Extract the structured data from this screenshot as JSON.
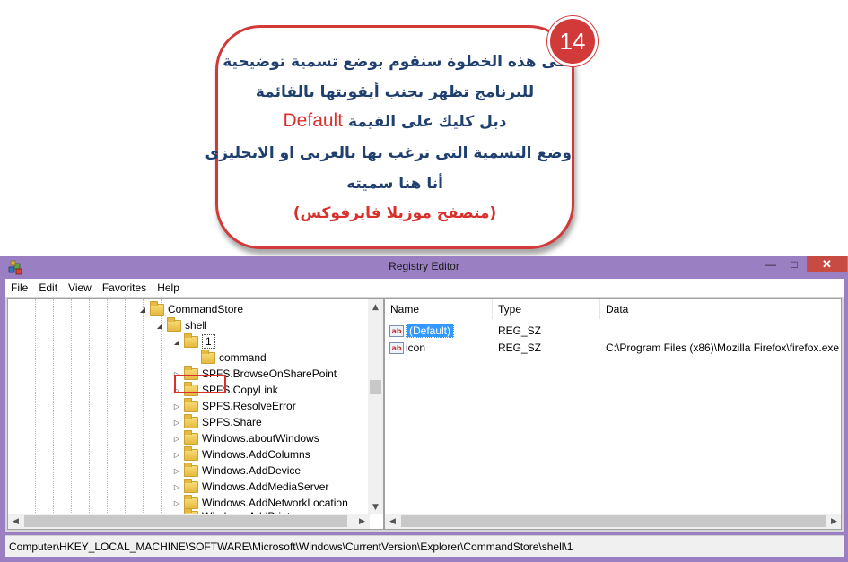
{
  "callout": {
    "badge_number": "14",
    "line1": "فى هذه الخطوة سنقوم بوضع تسمية توضيحية",
    "line2": "للبرنامج تظهر بجنب أيقونتها بالقائمة",
    "line3_prefix": "دبل كليك على القيمة",
    "line3_highlight": "Default",
    "line4": "وضع التسمية التى ترغب بها بالعربى او الانجليزى",
    "line5": "أنا هنا سميته",
    "line6": "(متصفح موزيلا فايرفوكس)",
    "accent_color": "#d23a3a",
    "text_color": "#1f3f6e"
  },
  "window": {
    "title": "Registry Editor",
    "app_icon": "registry-cubes-icon",
    "frame_color": "#9b7fc3",
    "minimize_glyph": "—",
    "maximize_glyph": "□",
    "close_glyph": "✕"
  },
  "menu": [
    "File",
    "Edit",
    "View",
    "Favorites",
    "Help"
  ],
  "tree": {
    "items": [
      {
        "label": "CommandStore",
        "expander": "◢"
      },
      {
        "label": "shell",
        "expander": "◢"
      },
      {
        "label": "1",
        "expander": "◢",
        "selected": true
      },
      {
        "label": "command",
        "expander": ""
      },
      {
        "label": "SPFS.BrowseOnSharePoint",
        "expander": "▷"
      },
      {
        "label": "SPFS.CopyLink",
        "expander": "▷"
      },
      {
        "label": "SPFS.ResolveError",
        "expander": "▷"
      },
      {
        "label": "SPFS.Share",
        "expander": "▷"
      },
      {
        "label": "Windows.aboutWindows",
        "expander": "▷"
      },
      {
        "label": "Windows.AddColumns",
        "expander": "▷"
      },
      {
        "label": "Windows.AddDevice",
        "expander": "▷"
      },
      {
        "label": "Windows.AddMediaServer",
        "expander": "▷"
      },
      {
        "label": "Windows.AddNetworkLocation",
        "expander": "▷"
      },
      {
        "label": "Windows.AddPrinter",
        "expander": "▷"
      }
    ]
  },
  "values": {
    "columns": {
      "name": "Name",
      "type": "Type",
      "data": "Data"
    },
    "rows": [
      {
        "name": "(Default)",
        "type": "REG_SZ",
        "data": "",
        "selected": true
      },
      {
        "name": "icon",
        "type": "REG_SZ",
        "data": "C:\\Program Files (x86)\\Mozilla Firefox\\firefox.exe"
      }
    ],
    "value_icon_text": "ab"
  },
  "status": {
    "path": "Computer\\HKEY_LOCAL_MACHINE\\SOFTWARE\\Microsoft\\Windows\\CurrentVersion\\Explorer\\CommandStore\\shell\\1"
  }
}
